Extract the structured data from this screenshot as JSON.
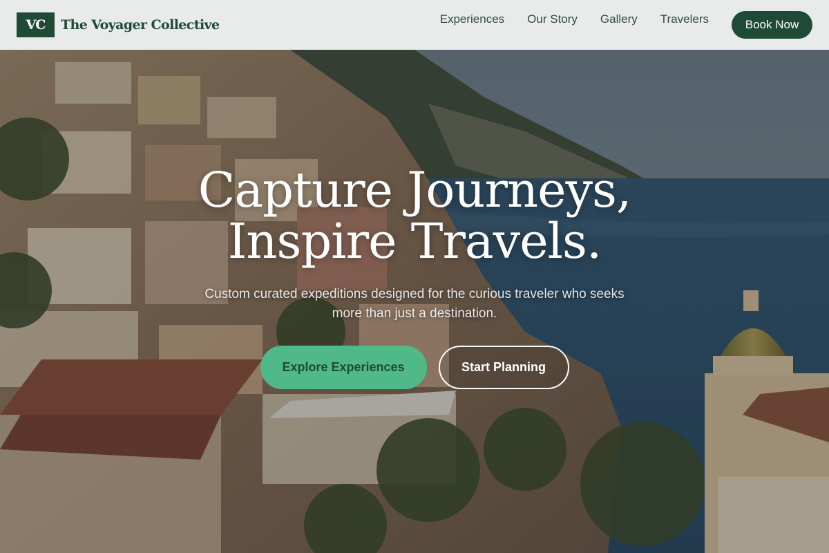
{
  "brand": {
    "mark": "VC",
    "name": "The Voyager Collective"
  },
  "nav": {
    "links": [
      "Experiences",
      "Our Story",
      "Gallery",
      "Travelers"
    ],
    "cta": "Book Now"
  },
  "hero": {
    "headline_line1": "Capture Journeys,",
    "headline_line2": "Inspire Travels.",
    "subtitle": "Custom curated expeditions designed for the curious traveler who seeks more than just a destination.",
    "primary_button": "Explore Experiences",
    "secondary_button": "Start Planning"
  },
  "colors": {
    "brand_green": "#1f4a36",
    "accent_green": "#4fb98a",
    "nav_background": "#f4f5f4"
  }
}
